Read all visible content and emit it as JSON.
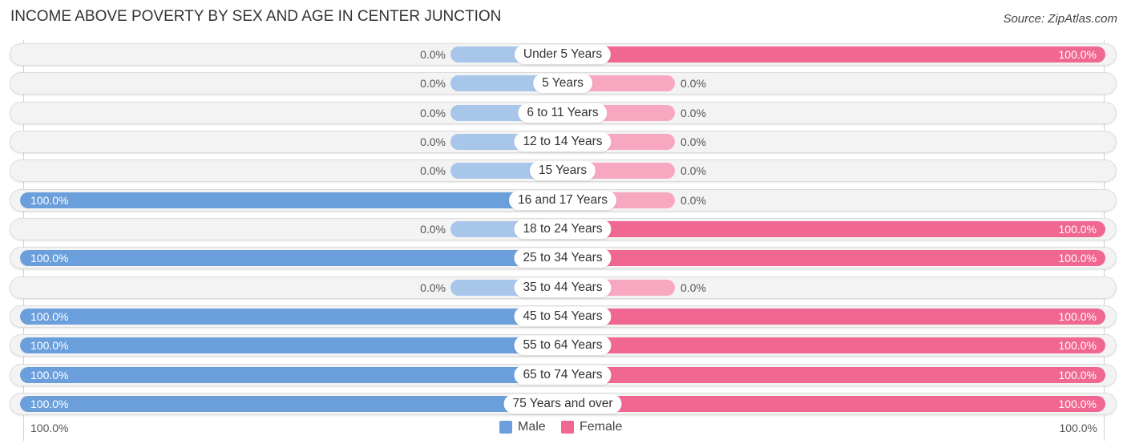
{
  "chart_data": {
    "type": "bar",
    "orientation": "horizontal-diverging",
    "title": "INCOME ABOVE POVERTY BY SEX AND AGE IN CENTER JUNCTION",
    "source": "Source: ZipAtlas.com",
    "categories": [
      "Under 5 Years",
      "5 Years",
      "6 to 11 Years",
      "12 to 14 Years",
      "15 Years",
      "16 and 17 Years",
      "18 to 24 Years",
      "25 to 34 Years",
      "35 to 44 Years",
      "45 to 54 Years",
      "55 to 64 Years",
      "65 to 74 Years",
      "75 Years and over"
    ],
    "series": [
      {
        "name": "Male",
        "color": "#6a9fdc",
        "zero_color": "#a8c6ea",
        "values": [
          0.0,
          0.0,
          0.0,
          0.0,
          0.0,
          100.0,
          0.0,
          100.0,
          0.0,
          100.0,
          100.0,
          100.0,
          100.0
        ],
        "labels": [
          "0.0%",
          "0.0%",
          "0.0%",
          "0.0%",
          "0.0%",
          "100.0%",
          "0.0%",
          "100.0%",
          "0.0%",
          "100.0%",
          "100.0%",
          "100.0%",
          "100.0%"
        ]
      },
      {
        "name": "Female",
        "color": "#f06792",
        "zero_color": "#f7a8c0",
        "values": [
          100.0,
          0.0,
          0.0,
          0.0,
          0.0,
          0.0,
          100.0,
          100.0,
          0.0,
          100.0,
          100.0,
          100.0,
          100.0
        ],
        "labels": [
          "100.0%",
          "0.0%",
          "0.0%",
          "0.0%",
          "0.0%",
          "0.0%",
          "100.0%",
          "100.0%",
          "0.0%",
          "100.0%",
          "100.0%",
          "100.0%",
          "100.0%"
        ]
      }
    ],
    "xlim": [
      -100,
      100
    ],
    "axis_labels": {
      "left": "100.0%",
      "right": "100.0%"
    },
    "legend": {
      "position": "bottom-center",
      "entries": [
        "Male",
        "Female"
      ]
    },
    "grid": false
  }
}
